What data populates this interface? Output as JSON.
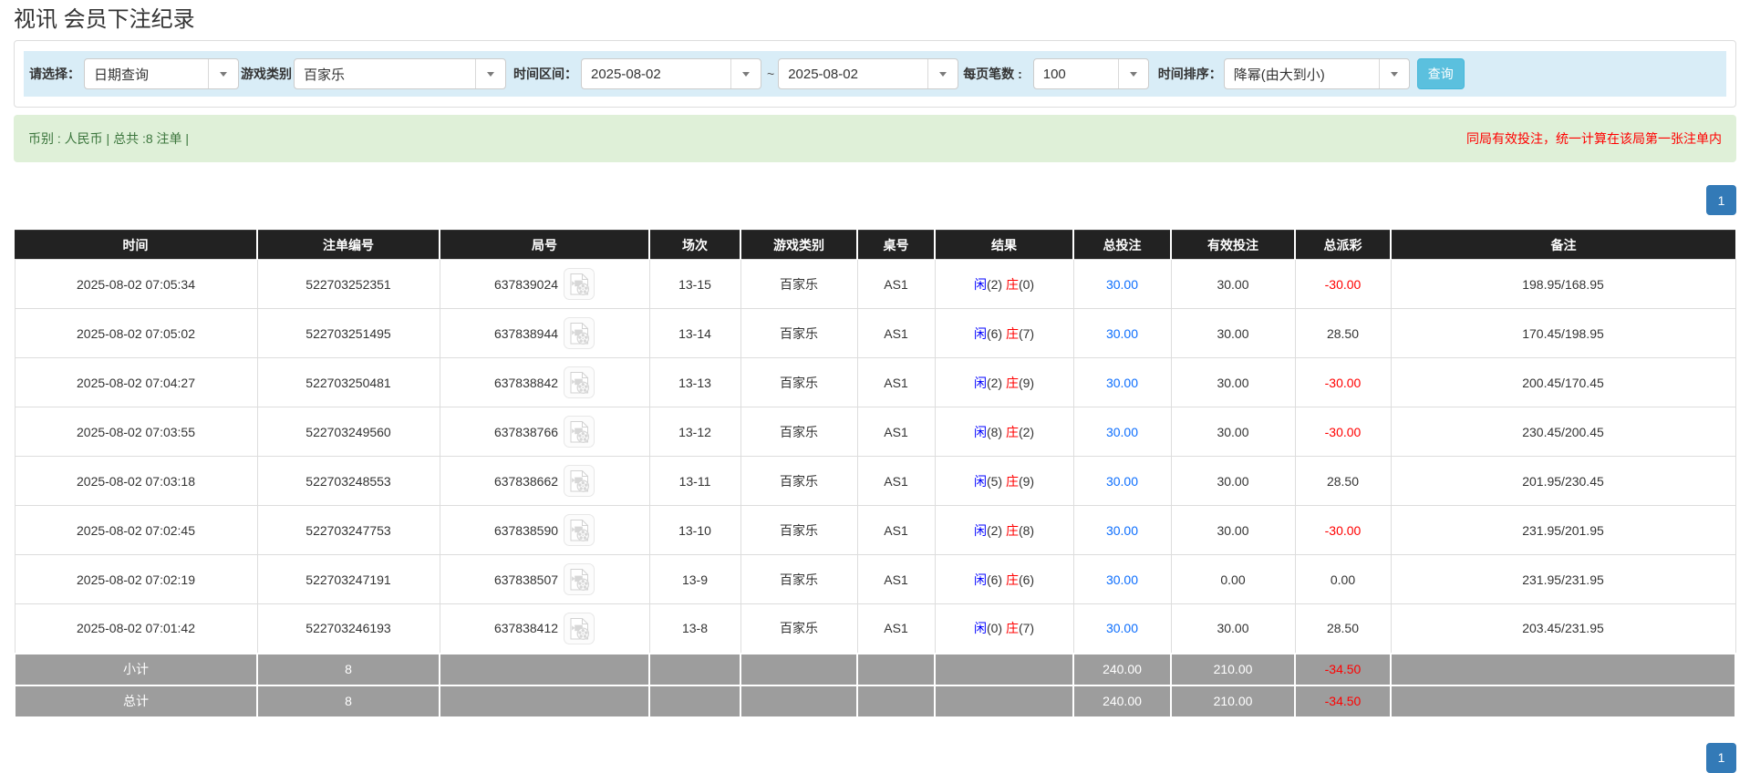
{
  "page_title": "视讯 会员下注纪录",
  "filters": {
    "select_label": "请选择：",
    "select_value": "日期查询",
    "game_label": "游戏类别",
    "game_value": "百家乐",
    "range_label": "时间区间：",
    "date_from": "2025-08-02",
    "range_separator": "~",
    "date_to": "2025-08-02",
    "page_size_label": "每页笔数 :",
    "page_size_value": "100",
    "sort_label": "时间排序：",
    "sort_value": "降幂(由大到小)",
    "search_button": "查询"
  },
  "summary": {
    "left_text": "币别 : 人民币 | 总共 :8 注单 |",
    "right_notice": "同局有效投注，统一计算在该局第一张注单内"
  },
  "pagination": {
    "current": "1"
  },
  "table": {
    "columns": [
      "时间",
      "注单编号",
      "局号",
      "场次",
      "游戏类别",
      "桌号",
      "结果",
      "总投注",
      "有效投注",
      "总派彩",
      "备注"
    ],
    "result_labels": {
      "player": "闲",
      "banker": "庄"
    },
    "video_icon": "video-file-icon",
    "rows": [
      {
        "time": "2025-08-02 07:05:34",
        "bet_no": "522703252351",
        "round_no": "637839024",
        "session": "13-15",
        "game": "百家乐",
        "table_no": "AS1",
        "player": "2",
        "banker": "0",
        "total_bet": "30.00",
        "valid_bet": "30.00",
        "payout": "-30.00",
        "remark": "198.95/168.95"
      },
      {
        "time": "2025-08-02 07:05:02",
        "bet_no": "522703251495",
        "round_no": "637838944",
        "session": "13-14",
        "game": "百家乐",
        "table_no": "AS1",
        "player": "6",
        "banker": "7",
        "total_bet": "30.00",
        "valid_bet": "30.00",
        "payout": "28.50",
        "remark": "170.45/198.95"
      },
      {
        "time": "2025-08-02 07:04:27",
        "bet_no": "522703250481",
        "round_no": "637838842",
        "session": "13-13",
        "game": "百家乐",
        "table_no": "AS1",
        "player": "2",
        "banker": "9",
        "total_bet": "30.00",
        "valid_bet": "30.00",
        "payout": "-30.00",
        "remark": "200.45/170.45"
      },
      {
        "time": "2025-08-02 07:03:55",
        "bet_no": "522703249560",
        "round_no": "637838766",
        "session": "13-12",
        "game": "百家乐",
        "table_no": "AS1",
        "player": "8",
        "banker": "2",
        "total_bet": "30.00",
        "valid_bet": "30.00",
        "payout": "-30.00",
        "remark": "230.45/200.45"
      },
      {
        "time": "2025-08-02 07:03:18",
        "bet_no": "522703248553",
        "round_no": "637838662",
        "session": "13-11",
        "game": "百家乐",
        "table_no": "AS1",
        "player": "5",
        "banker": "9",
        "total_bet": "30.00",
        "valid_bet": "30.00",
        "payout": "28.50",
        "remark": "201.95/230.45"
      },
      {
        "time": "2025-08-02 07:02:45",
        "bet_no": "522703247753",
        "round_no": "637838590",
        "session": "13-10",
        "game": "百家乐",
        "table_no": "AS1",
        "player": "2",
        "banker": "8",
        "total_bet": "30.00",
        "valid_bet": "30.00",
        "payout": "-30.00",
        "remark": "231.95/201.95"
      },
      {
        "time": "2025-08-02 07:02:19",
        "bet_no": "522703247191",
        "round_no": "637838507",
        "session": "13-9",
        "game": "百家乐",
        "table_no": "AS1",
        "player": "6",
        "banker": "6",
        "total_bet": "30.00",
        "valid_bet": "0.00",
        "payout": "0.00",
        "remark": "231.95/231.95"
      },
      {
        "time": "2025-08-02 07:01:42",
        "bet_no": "522703246193",
        "round_no": "637838412",
        "session": "13-8",
        "game": "百家乐",
        "table_no": "AS1",
        "player": "0",
        "banker": "7",
        "total_bet": "30.00",
        "valid_bet": "30.00",
        "payout": "28.50",
        "remark": "203.45/231.95"
      }
    ],
    "subtotal": {
      "label": "小计",
      "count": "8",
      "total_bet": "240.00",
      "valid_bet": "210.00",
      "payout": "-34.50"
    },
    "total": {
      "label": "总计",
      "count": "8",
      "total_bet": "240.00",
      "valid_bet": "210.00",
      "payout": "-34.50"
    }
  },
  "colors": {
    "header_dark": "#222222",
    "footer_gray": "#9d9d9d",
    "player_blue": "#0000ff",
    "banker_red": "#ff0000",
    "link_blue": "#0d6efd",
    "negative_red": "#ff0000",
    "notice_red": "#ff0000",
    "button_cyan": "#5bc0de",
    "pagination_blue": "#337ab7",
    "filter_bar_bg": "#d9edf7",
    "summary_bg": "#dff0d8",
    "summary_text": "#3c763d",
    "panel_border": "#dddddd"
  }
}
